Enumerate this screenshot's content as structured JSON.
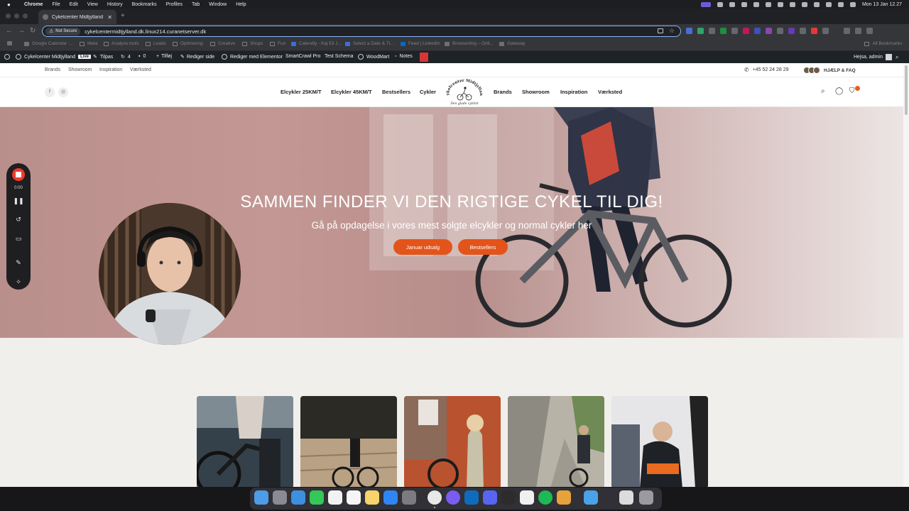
{
  "menubar": {
    "app": "Chrome",
    "items": [
      "File",
      "Edit",
      "View",
      "History",
      "Bookmarks",
      "Profiles",
      "Tab",
      "Window",
      "Help"
    ],
    "clock": "Mon 13 Jan  12.27"
  },
  "browser": {
    "tab_title": "Cykelcenter Midtjylland - Din",
    "not_secure": "Not Secure",
    "url": "cykelcentermidtjylland.dk.linux214.curanetserver.dk",
    "bookmarks": [
      "Google Calendar -...",
      "Meta",
      "Analyse tools",
      "Leads",
      "Optimering",
      "Creative",
      "Shops",
      "Fun",
      "Calendly - Kaj Eli J...",
      "Select a Date & Ti...",
      "Feed | LinkedIn",
      "Browserling – Onli...",
      "Gateway"
    ],
    "all_bookmarks": "All Bookmarks"
  },
  "wpbar": {
    "site_name": "Cykelcenter Midtjylland",
    "live": "Live",
    "customize": "Tilpas",
    "updates": "4",
    "comments": "0",
    "new": "Tilføj",
    "edit_page": "Rediger side",
    "elementor": "Rediger med Elementor",
    "smartcrawl": "SmartCrawl Pro",
    "test_schema": "Test Schema",
    "woodmart": "WoodMart",
    "notes": "Notes",
    "greeting": "Hejsa, admin"
  },
  "site": {
    "top_links": [
      "Brands",
      "Showroom",
      "Inspiration",
      "Værksted"
    ],
    "phone": "+45 52 24 28 29",
    "faq": "HJÆLP & FAQ",
    "social": [
      "f",
      "◎"
    ],
    "nav_left": [
      "Elcykler 25KM/T",
      "Elcykler 45KM/T",
      "Bestsellers",
      "Cykler"
    ],
    "nav_right": [
      "Brands",
      "Showroom",
      "Inspiration",
      "Værksted"
    ],
    "logo_text": "Cykelcenter Midtjylland",
    "logo_tagline": "Den glade cyklist",
    "hero_title": "SAMMEN FINDER VI DEN RIGTIGE CYKEL TIL DIG!",
    "hero_subtitle": "Gå på opdagelse i vores mest solgte elcykler og normal cykler her",
    "btn_january": "Januar udsalg",
    "btn_bestsellers": "Bestsellers"
  },
  "recorder": {
    "time": "0:00"
  },
  "colors": {
    "accent": "#e3541b",
    "wp_admin": "#1d2327",
    "omnibox_focus": "#8ab4f8"
  }
}
